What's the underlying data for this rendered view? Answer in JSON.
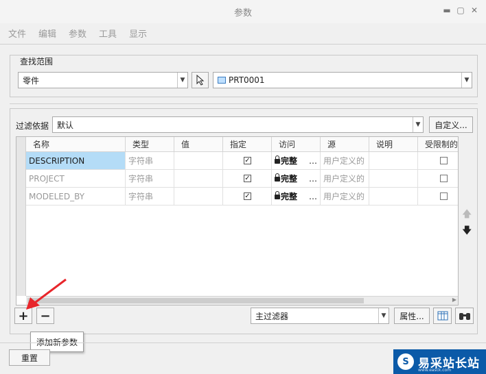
{
  "window": {
    "title": "参数"
  },
  "menu": [
    "文件",
    "编辑",
    "参数",
    "工具",
    "显示"
  ],
  "scope": {
    "legend": "查找范围",
    "type_value": "零件",
    "part_value": "PRT0001"
  },
  "filter": {
    "label": "过滤依据",
    "value": "默认",
    "customize_label": "自定义..."
  },
  "table": {
    "headers": [
      "名称",
      "类型",
      "值",
      "指定",
      "访问",
      "源",
      "说明",
      "受限制的"
    ],
    "rows": [
      {
        "name": "DESCRIPTION",
        "type": "字符串",
        "value": "",
        "designate": true,
        "access": "完整",
        "source": "用户定义的",
        "desc": "",
        "restricted": false
      },
      {
        "name": "PROJECT",
        "type": "字符串",
        "value": "",
        "designate": true,
        "access": "完整",
        "source": "用户定义的",
        "desc": "",
        "restricted": false
      },
      {
        "name": "MODELED_BY",
        "type": "字符串",
        "value": "",
        "designate": true,
        "access": "完整",
        "source": "用户定义的",
        "desc": "",
        "restricted": false
      }
    ]
  },
  "bottom": {
    "main_filter": "主过滤器",
    "properties_label": "属性...",
    "tooltip": "添加新参数",
    "reset_label": "重置"
  },
  "colors": {
    "selection": "#b4dcf7",
    "accent_arrow": "#e8262b",
    "watermark_bg": "#0b5aa8"
  },
  "watermark": {
    "logo_char": "S",
    "text": "易采站长站",
    "sub": "www.easck.com"
  }
}
